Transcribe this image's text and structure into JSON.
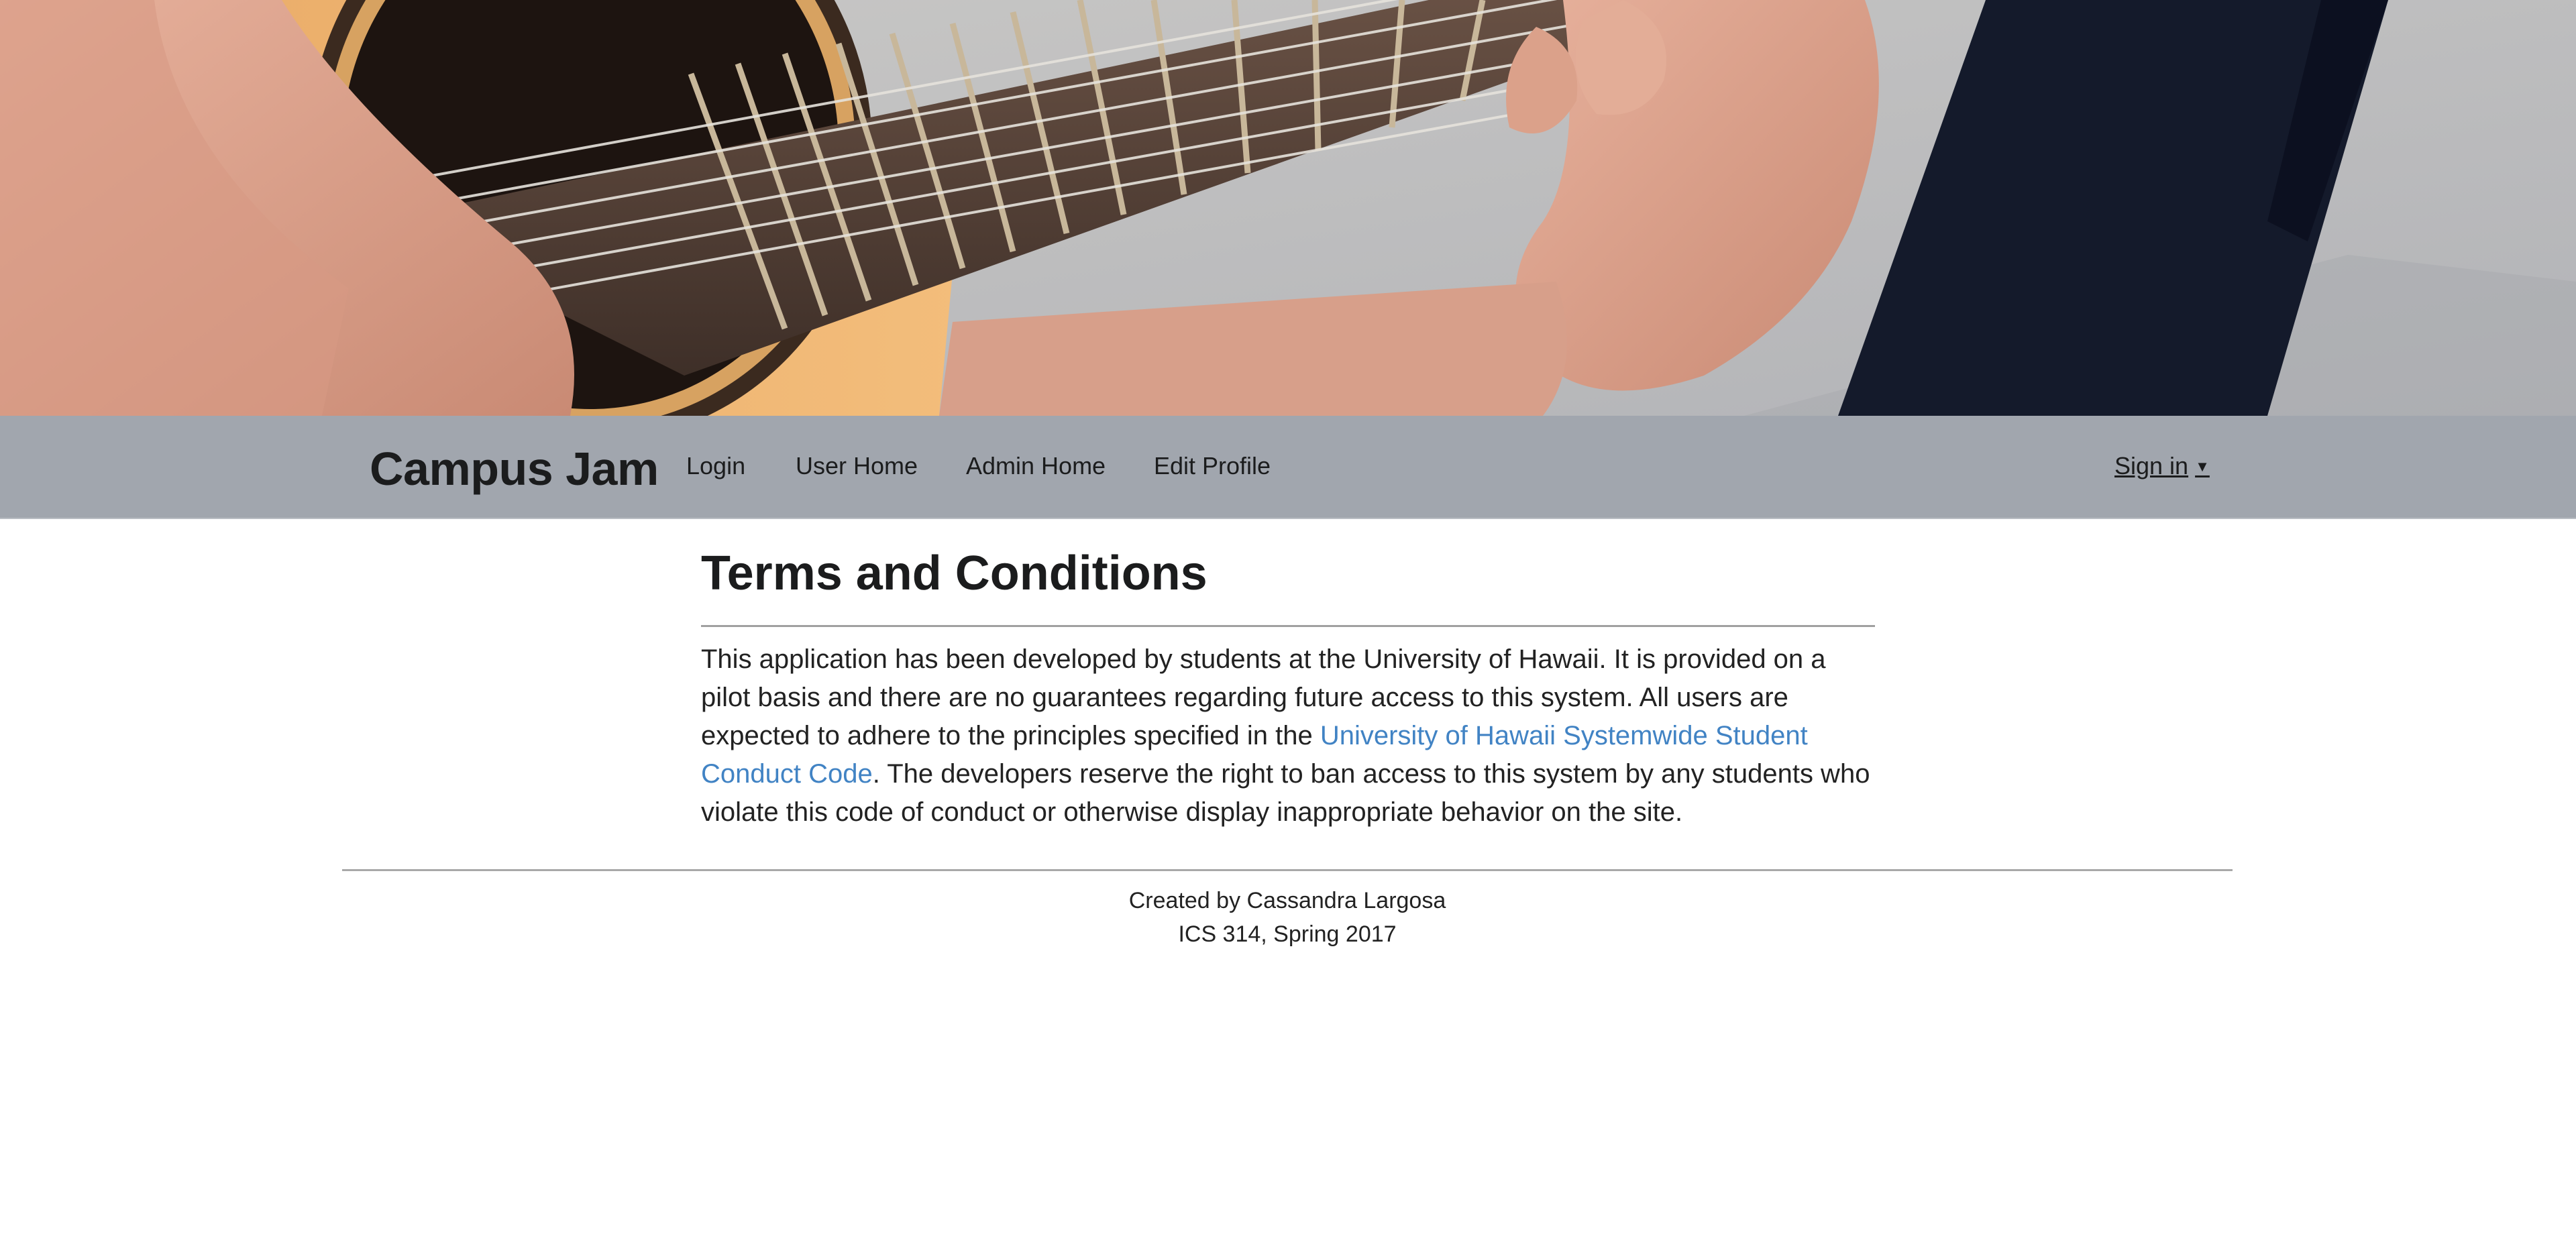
{
  "navbar": {
    "brand": "Campus Jam",
    "items": [
      {
        "label": "Login"
      },
      {
        "label": "User Home"
      },
      {
        "label": "Admin Home"
      },
      {
        "label": "Edit Profile"
      }
    ],
    "signin_label": "Sign in",
    "signin_icon": "caret-down-icon"
  },
  "main": {
    "title": "Terms and Conditions",
    "paragraph_before_link": "This application has been developed by students at the University of Hawaii. It is provided on a pilot basis and there are no guarantees regarding future access to this system. All users are expected to adhere to the principles specified in the ",
    "link_text": "University of Hawaii Systemwide Student Conduct Code",
    "paragraph_after_link": ". The developers reserve the right to ban access to this system by any students who violate this code of conduct or otherwise display inappropriate behavior on the site."
  },
  "footer": {
    "line1": "Created by Cassandra Largosa",
    "line2": "ICS 314, Spring 2017"
  },
  "colors": {
    "navbar_bg": "#a1a6ae",
    "link": "#4183c4",
    "text": "#222222"
  }
}
